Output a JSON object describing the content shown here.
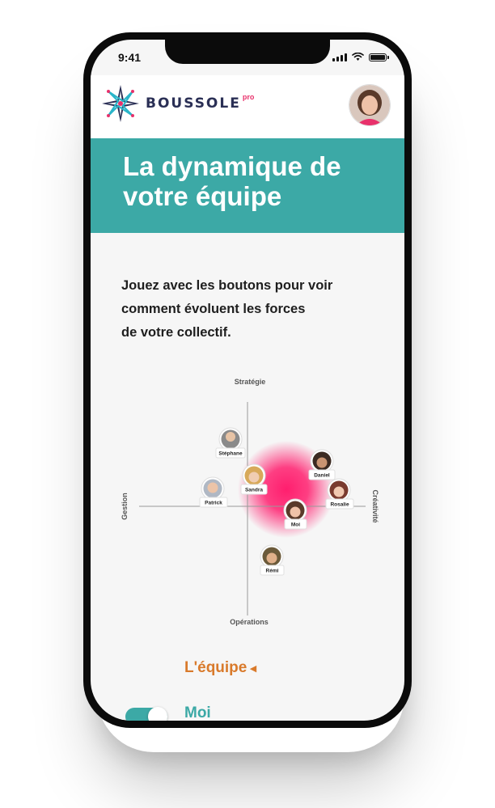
{
  "status_bar": {
    "time": "9:41"
  },
  "header": {
    "brand": "BOUSSOLE",
    "badge": "pro"
  },
  "hero": {
    "title": "La dynamique de votre équipe"
  },
  "intro": {
    "line1": "Jouez avec les boutons pour voir",
    "line2": "comment évoluent les forces",
    "line3": "de votre collectif."
  },
  "compass": {
    "axes": {
      "top": "Stratégie",
      "bottom": "Opérations",
      "left": "Gestion",
      "right": "Créativité"
    },
    "members": [
      "Stéphane",
      "Daniel",
      "Sandra",
      "Patrick",
      "Rosalie",
      "Moi",
      "Rémi"
    ],
    "highlight_color": "#ff1e6e"
  },
  "controls": {
    "team_label": "L'équipe",
    "me_label": "Moi",
    "me_toggle_on": true
  },
  "colors": {
    "teal": "#3ca9a6",
    "orange": "#d97a2b",
    "navy": "#2a2f55",
    "pink": "#e8316b"
  }
}
